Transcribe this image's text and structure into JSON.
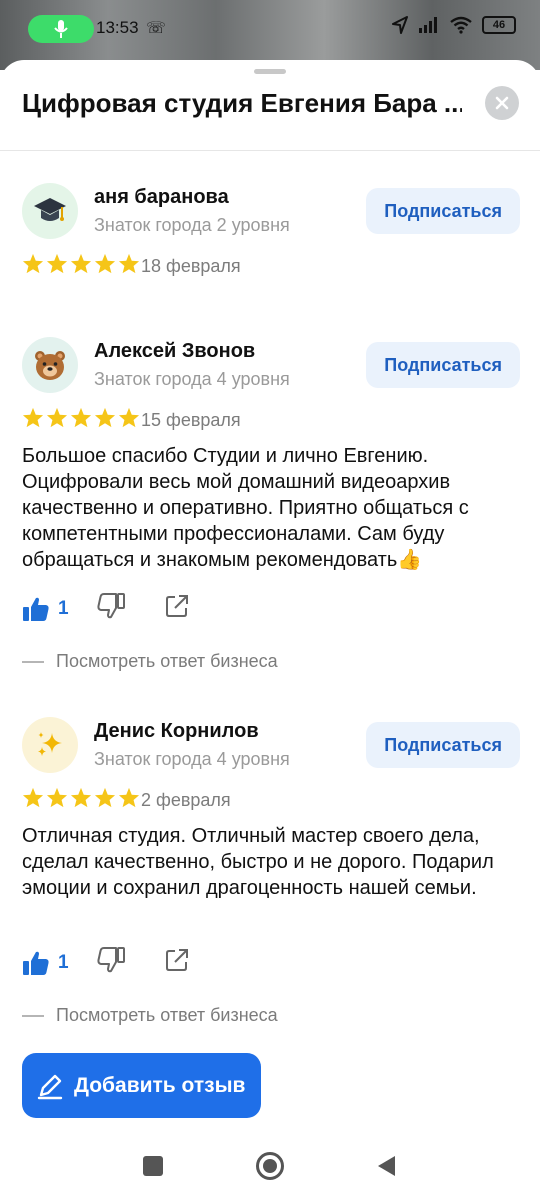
{
  "status_bar": {
    "time": "13:53",
    "battery": "46"
  },
  "sheet": {
    "title": "Цифровая студия Евгения Бара ..."
  },
  "reviews": [
    {
      "name": "аня баранова",
      "level": "Знаток города 2 уровня",
      "subscribe_label": "Подписаться",
      "date": "18 февраля",
      "rating": 5,
      "avatar_icon": "graduation-cap"
    },
    {
      "name": "Алексей Звонов",
      "level": "Знаток города 4 уровня",
      "subscribe_label": "Подписаться",
      "date": "15 февраля",
      "rating": 5,
      "avatar_icon": "bear",
      "text": "Большое спасибо Студии и лично Евгению. Оцифровали весь мой домашний видеоархив качественно и оперативно. Приятно общаться с компетентными профессионалами. Сам буду обращаться и знакомым рекомендовать👍",
      "likes": "1",
      "business_reply_label": "Посмотреть ответ бизнеса"
    },
    {
      "name": "Денис Корнилов",
      "level": "Знаток города 4 уровня",
      "subscribe_label": "Подписаться",
      "date": "2 февраля",
      "rating": 5,
      "avatar_icon": "sparkles",
      "text": "Отличная студия. Отличный мастер своего дела, сделал качественно, быстро и не дорого. Подарил эмоции и сохранил драгоценность нашей семьи.",
      "likes": "1",
      "business_reply_label": "Посмотреть ответ бизнеса"
    }
  ],
  "add_review_label": "Добавить отзыв",
  "colors": {
    "accent": "#1f6fe8",
    "star": "#f5c518",
    "link": "#1f5fbf"
  }
}
